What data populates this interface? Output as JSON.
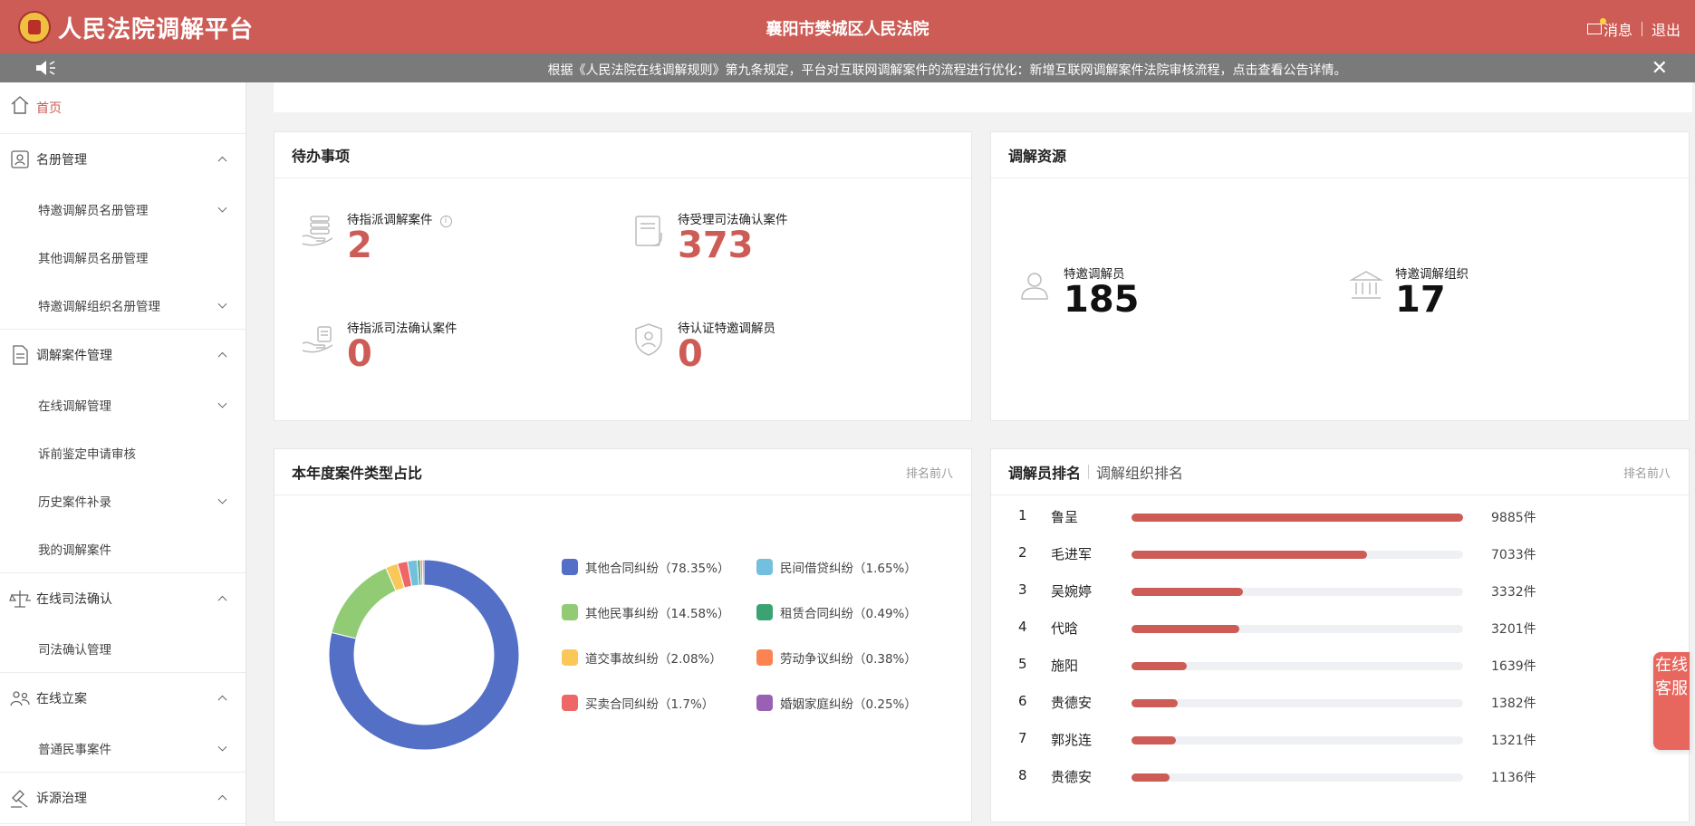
{
  "header": {
    "app_title": "人民法院调解平台",
    "court_name": "襄阳市樊城区人民法院",
    "messages_label": "消息",
    "logout_label": "退出"
  },
  "notice": {
    "text": "根据《人民法院在线调解规则》第九条规定，平台对互联网调解案件的流程进行优化：新增互联网调解案件法院审核流程，点击查看公告详情。",
    "close_glyph": "✕"
  },
  "sidebar": {
    "home": "首页",
    "groups": [
      {
        "label": "名册管理",
        "items": [
          "特邀调解员名册管理",
          "其他调解员名册管理",
          "特邀调解组织名册管理"
        ]
      },
      {
        "label": "调解案件管理",
        "items": [
          "在线调解管理",
          "诉前鉴定申请审核",
          "历史案件补录",
          "我的调解案件"
        ]
      },
      {
        "label": "在线司法确认",
        "items": [
          "司法确认管理"
        ]
      },
      {
        "label": "在线立案",
        "items": [
          "普通民事案件"
        ]
      },
      {
        "label": "诉源治理",
        "items": []
      }
    ]
  },
  "todo": {
    "title": "待办事项",
    "items": [
      {
        "label": "待指派调解案件",
        "value": "2",
        "icon": "hand-coins-icon"
      },
      {
        "label": "待受理司法确认案件",
        "value": "373",
        "icon": "document-icon"
      },
      {
        "label": "待指派司法确认案件",
        "value": "0",
        "icon": "hand-document-icon"
      },
      {
        "label": "待认证特邀调解员",
        "value": "0",
        "icon": "shield-user-icon"
      }
    ]
  },
  "resources": {
    "title": "调解资源",
    "items": [
      {
        "label": "特邀调解员",
        "value": "185",
        "icon": "person-icon"
      },
      {
        "label": "特邀调解组织",
        "value": "17",
        "icon": "institution-icon"
      }
    ]
  },
  "case_types": {
    "title": "本年度案件类型占比",
    "extra": "排名前八"
  },
  "chart_data": {
    "type": "pie",
    "variant": "donut",
    "title": "本年度案件类型占比",
    "legend_position": "right",
    "slices": [
      {
        "name": "其他合同纠纷",
        "value": 78.35,
        "label": "其他合同纠纷（78.35%）",
        "color": "#5470c6"
      },
      {
        "name": "其他民事纠纷",
        "value": 14.58,
        "label": "其他民事纠纷（14.58%）",
        "color": "#91cc75"
      },
      {
        "name": "道交事故纠纷",
        "value": 2.08,
        "label": "道交事故纠纷（2.08%）",
        "color": "#fac858"
      },
      {
        "name": "买卖合同纠纷",
        "value": 1.7,
        "label": "买卖合同纠纷（1.7%）",
        "color": "#ee6666"
      },
      {
        "name": "民间借贷纠纷",
        "value": 1.65,
        "label": "民间借贷纠纷（1.65%）",
        "color": "#73c0de"
      },
      {
        "name": "租赁合同纠纷",
        "value": 0.49,
        "label": "租赁合同纠纷（0.49%）",
        "color": "#3ba272"
      },
      {
        "name": "劳动争议纠纷",
        "value": 0.38,
        "label": "劳动争议纠纷（0.38%）",
        "color": "#fc8452"
      },
      {
        "name": "婚姻家庭纠纷",
        "value": 0.25,
        "label": "婚姻家庭纠纷（0.25%）",
        "color": "#9a60b4"
      }
    ]
  },
  "ranking": {
    "tabs": [
      "调解员排名",
      "调解组织排名"
    ],
    "extra": "排名前八",
    "max": 9885,
    "rows": [
      {
        "rank": "1",
        "name": "鲁呈",
        "value": 9885,
        "count_label": "9885件"
      },
      {
        "rank": "2",
        "name": "毛进军",
        "value": 7033,
        "count_label": "7033件"
      },
      {
        "rank": "3",
        "name": "吴婉婷",
        "value": 3332,
        "count_label": "3332件"
      },
      {
        "rank": "4",
        "name": "代晗",
        "value": 3201,
        "count_label": "3201件"
      },
      {
        "rank": "5",
        "name": "施阳",
        "value": 1639,
        "count_label": "1639件"
      },
      {
        "rank": "6",
        "name": "贵德安",
        "value": 1382,
        "count_label": "1382件"
      },
      {
        "rank": "7",
        "name": "郭兆连",
        "value": 1321,
        "count_label": "1321件"
      },
      {
        "rank": "8",
        "name": "贵德安",
        "value": 1136,
        "count_label": "1136件"
      }
    ]
  },
  "float_service": {
    "label": "在线客服"
  },
  "colors": {
    "brand": "#cd5c56",
    "notice_bg": "#7a7a7a"
  }
}
